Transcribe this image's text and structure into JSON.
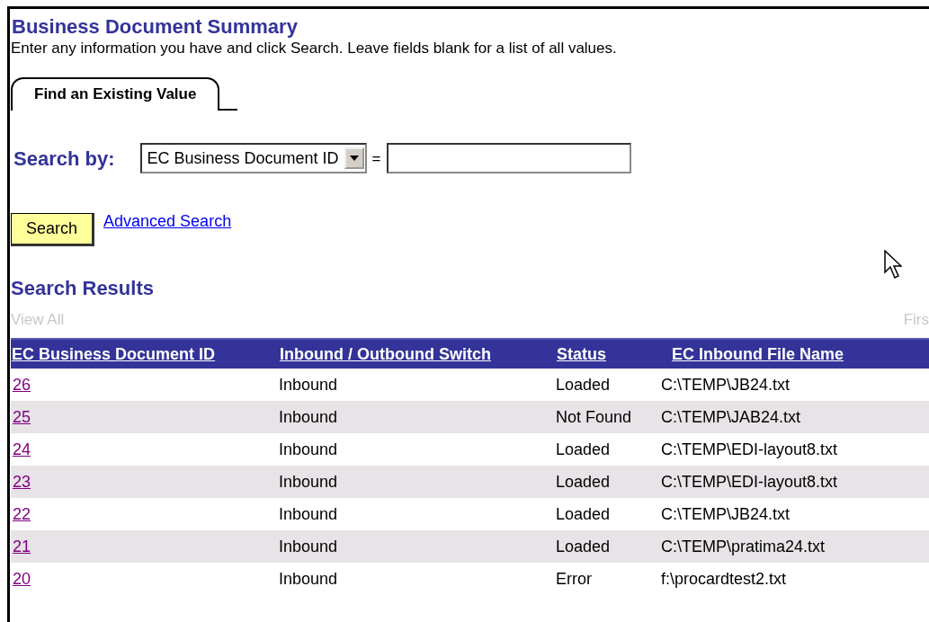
{
  "page": {
    "title": "Business Document Summary",
    "instructions": "Enter any information you have and click Search. Leave fields blank for a list of all values."
  },
  "tabs": [
    {
      "label": "Find an Existing Value",
      "selected": true
    }
  ],
  "search": {
    "label": "Search by:",
    "field_select": "EC Business Document ID",
    "operator": "=",
    "button": "Search",
    "advanced_link": "Advanced Search"
  },
  "results": {
    "title": "Search Results",
    "view_all": "View All",
    "pager": "Firs",
    "columns": [
      "EC Business Document ID",
      "Inbound / Outbound Switch",
      "Status",
      "EC Inbound File Name"
    ],
    "rows": [
      {
        "id": "26",
        "direction": "Inbound",
        "status": "Loaded",
        "file": "C:\\TEMP\\JB24.txt"
      },
      {
        "id": "25",
        "direction": "Inbound",
        "status": "Not Found",
        "file": "C:\\TEMP\\JAB24.txt"
      },
      {
        "id": "24",
        "direction": "Inbound",
        "status": "Loaded",
        "file": "C:\\TEMP\\EDI-layout8.txt"
      },
      {
        "id": "23",
        "direction": "Inbound",
        "status": "Loaded",
        "file": "C:\\TEMP\\EDI-layout8.txt"
      },
      {
        "id": "22",
        "direction": "Inbound",
        "status": "Loaded",
        "file": "C:\\TEMP\\JB24.txt"
      },
      {
        "id": "21",
        "direction": "Inbound",
        "status": "Loaded",
        "file": "C:\\TEMP\\pratima24.txt"
      },
      {
        "id": "20",
        "direction": "Inbound",
        "status": "Error",
        "file": "f:\\procardtest2.txt"
      }
    ]
  }
}
